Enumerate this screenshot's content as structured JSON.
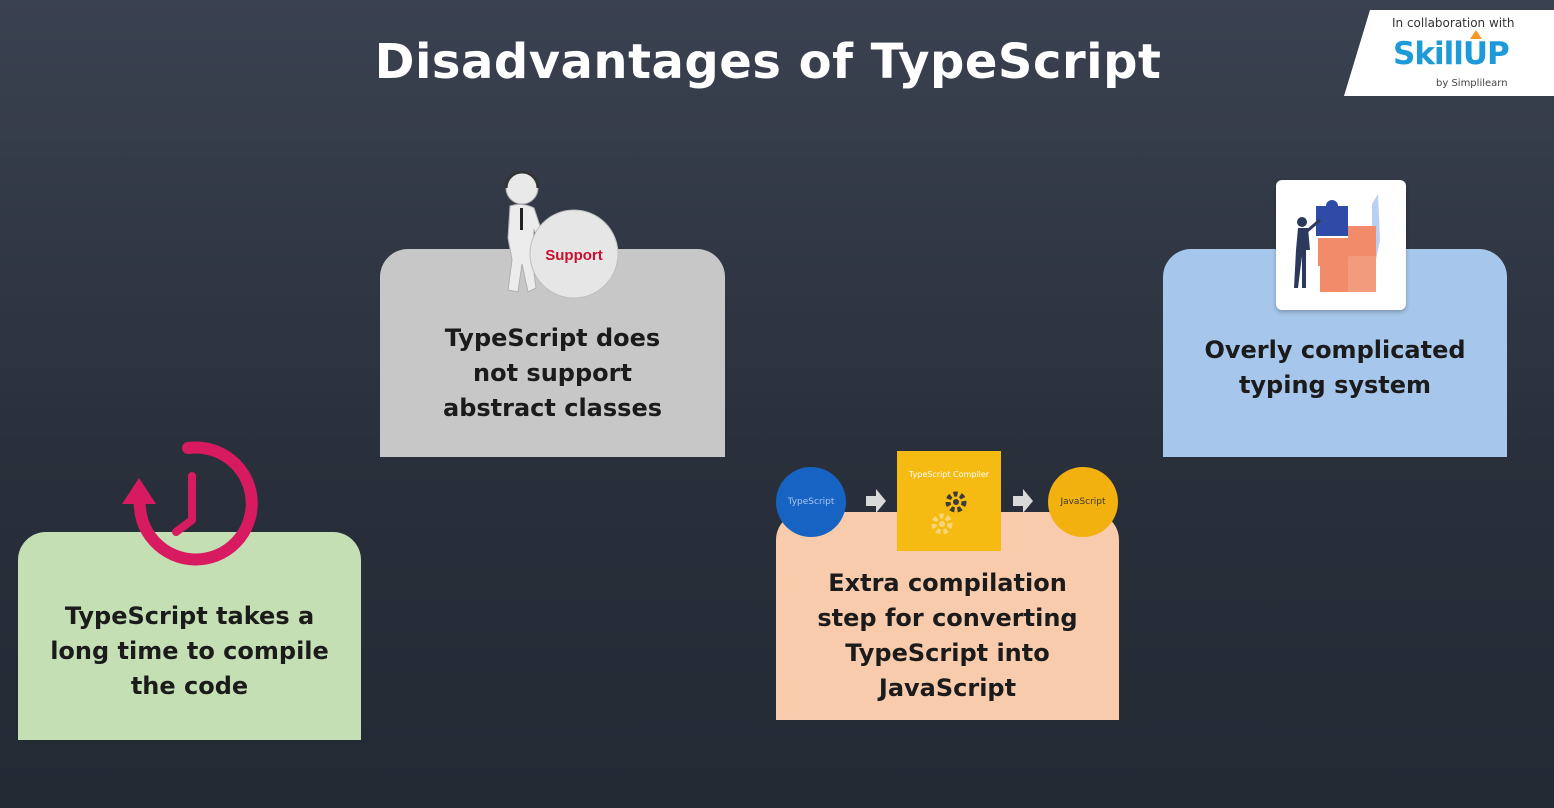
{
  "slide": {
    "title": "Disadvantages of TypeScript"
  },
  "logo": {
    "collab_text": "In collaboration with",
    "brand": "SkillUP",
    "sub_text": "by Simplilearn"
  },
  "cards": {
    "abstract": {
      "badge": "Support",
      "lines": [
        "TypeScript does",
        "not support",
        "abstract classes"
      ]
    },
    "typing": {
      "lines": [
        "Overly complicated",
        "typing system"
      ]
    },
    "compile_time": {
      "lines": [
        "TypeScript takes a",
        "long time to compile",
        "the code"
      ]
    },
    "compilation_step": {
      "flow_left": "TypeScript",
      "flow_middle": "TypeScript Compiler",
      "flow_right": "JavaScript",
      "lines": [
        "Extra compilation",
        "step for converting",
        "TypeScript into",
        "JavaScript"
      ]
    }
  },
  "colors": {
    "grey_card": "#c7c7c8",
    "blue_card": "#a6c6eb",
    "green_card": "#c5dfb4",
    "orange_card": "#f8cbac",
    "clock_accent": "#d81b60",
    "brand_blue": "#1f9ad8"
  },
  "icons": [
    "support-person-icon",
    "puzzle-icon",
    "clock-icon",
    "gear-icon",
    "arrow-right-icon"
  ]
}
